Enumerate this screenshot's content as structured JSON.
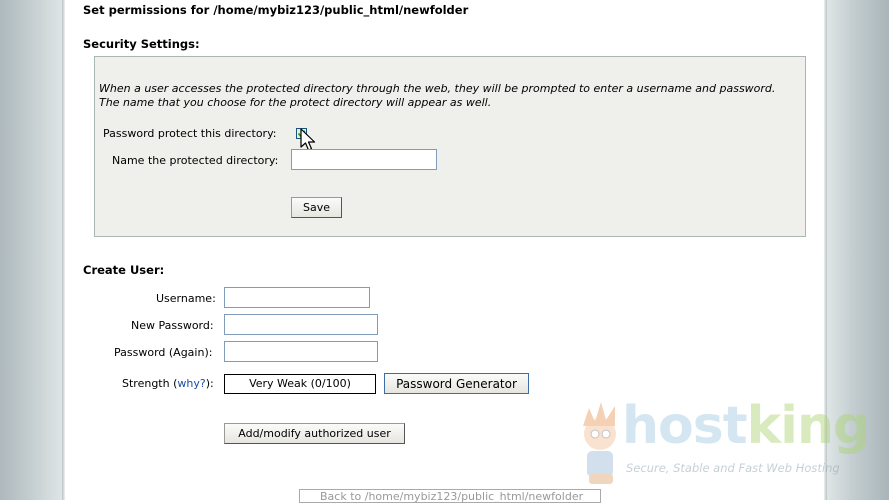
{
  "header": {
    "permissions_title": "Set permissions for /home/mybiz123/public_html/newfolder"
  },
  "security": {
    "title": "Security Settings:",
    "description_line1": "When a user accesses the protected directory through the web, they will be prompted to enter a username and password.",
    "description_line2": "The name that you choose for the protect directory will appear as well.",
    "protect_label": "Password protect this directory:",
    "protect_checked": true,
    "name_label": "Name the protected directory:",
    "name_value": "",
    "save_label": "Save"
  },
  "create_user": {
    "title": "Create User:",
    "username_label": "Username:",
    "username_value": "",
    "new_password_label": "New Password:",
    "new_password_value": "",
    "password_again_label": "Password (Again):",
    "password_again_value": "",
    "strength_label_prefix": "Strength (",
    "strength_why": "why?",
    "strength_label_suffix": "):",
    "strength_value": "Very Weak (0/100)",
    "generator_label": "Password Generator",
    "submit_label": "Add/modify authorized user"
  },
  "footer": {
    "back_link": "Back to /home/mybiz123/public_html/newfolder"
  },
  "watermark": {
    "brand_host": "host",
    "brand_king": "king",
    "tagline": "Secure, Stable and Fast Web Hosting"
  }
}
